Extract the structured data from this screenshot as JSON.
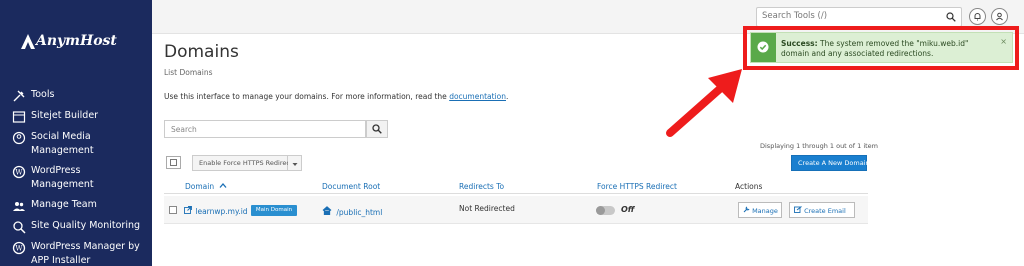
{
  "brand": {
    "name": "AnymHost"
  },
  "sidebar": {
    "items": [
      {
        "label": "Tools",
        "icon": "tools-icon"
      },
      {
        "label": "Sitejet Builder",
        "icon": "sitejet-icon"
      },
      {
        "label": "Social Media Management",
        "icon": "social-media-icon"
      },
      {
        "label": "WordPress Management",
        "icon": "wordpress-icon"
      },
      {
        "label": "Manage Team",
        "icon": "team-icon"
      },
      {
        "label": "Site Quality Monitoring",
        "icon": "search-quality-icon"
      },
      {
        "label": "WordPress Manager by APP Installer",
        "icon": "wordpress-icon"
      }
    ]
  },
  "topbar": {
    "search_placeholder": "Search Tools (/)"
  },
  "page": {
    "title": "Domains",
    "subtitle": "List Domains",
    "description": "Use this interface to manage your domains. For more information, read the",
    "doc_link": "documentation",
    "period": "."
  },
  "search": {
    "placeholder": "Search"
  },
  "pagination": {
    "text": "Displaying 1 through 1 out of 1 item"
  },
  "toolbar": {
    "https_button": "Enable Force HTTPS Redirect",
    "create_button": "Create A New Domain"
  },
  "table": {
    "headers": {
      "domain": "Domain",
      "docroot": "Document Root",
      "redirects": "Redirects To",
      "https": "Force HTTPS Redirect",
      "actions": "Actions"
    },
    "rows": [
      {
        "domain": "learnwp.my.id",
        "badge": "Main Domain",
        "docroot": "/public_html",
        "redirects": "Not Redirected",
        "https_state": "Off",
        "manage": "Manage",
        "create_email": "Create Email"
      }
    ]
  },
  "alert": {
    "title": "Success:",
    "message": "The system removed the \"miku.web.id\" domain and any associated redirections.",
    "close": "×"
  },
  "colors": {
    "sidebar": "#1b2a5e",
    "accent": "#1a7fcf",
    "success": "#5aa94a",
    "annotation": "#ee1c1c"
  }
}
